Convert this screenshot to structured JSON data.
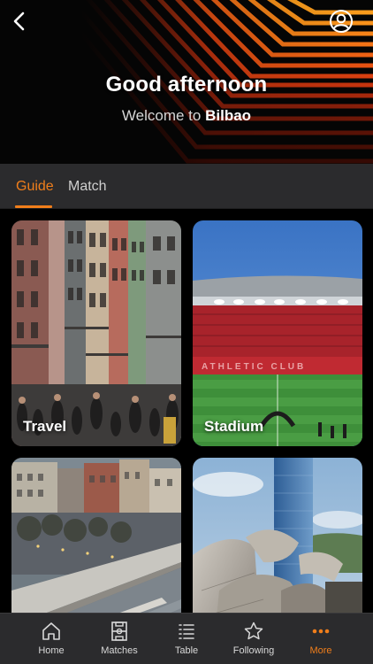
{
  "header": {
    "greeting": "Good afternoon",
    "welcome_prefix": "Welcome to",
    "city": "Bilbao"
  },
  "tabs": [
    {
      "label": "Guide",
      "active": true
    },
    {
      "label": "Match",
      "active": false
    }
  ],
  "cards": [
    {
      "label": "Travel"
    },
    {
      "label": "Stadium"
    },
    {
      "label": ""
    },
    {
      "label": ""
    }
  ],
  "bottom_nav": [
    {
      "label": "Home",
      "icon": "home-icon",
      "active": false
    },
    {
      "label": "Matches",
      "icon": "pitch-icon",
      "active": false
    },
    {
      "label": "Table",
      "icon": "list-icon",
      "active": false
    },
    {
      "label": "Following",
      "icon": "star-icon",
      "active": false
    },
    {
      "label": "More",
      "icon": "more-dots-icon",
      "active": true
    }
  ],
  "colors": {
    "accent": "#f07e1b",
    "background": "#000000",
    "bar": "#2b2b2d",
    "header_stripes": "#e85a12"
  }
}
